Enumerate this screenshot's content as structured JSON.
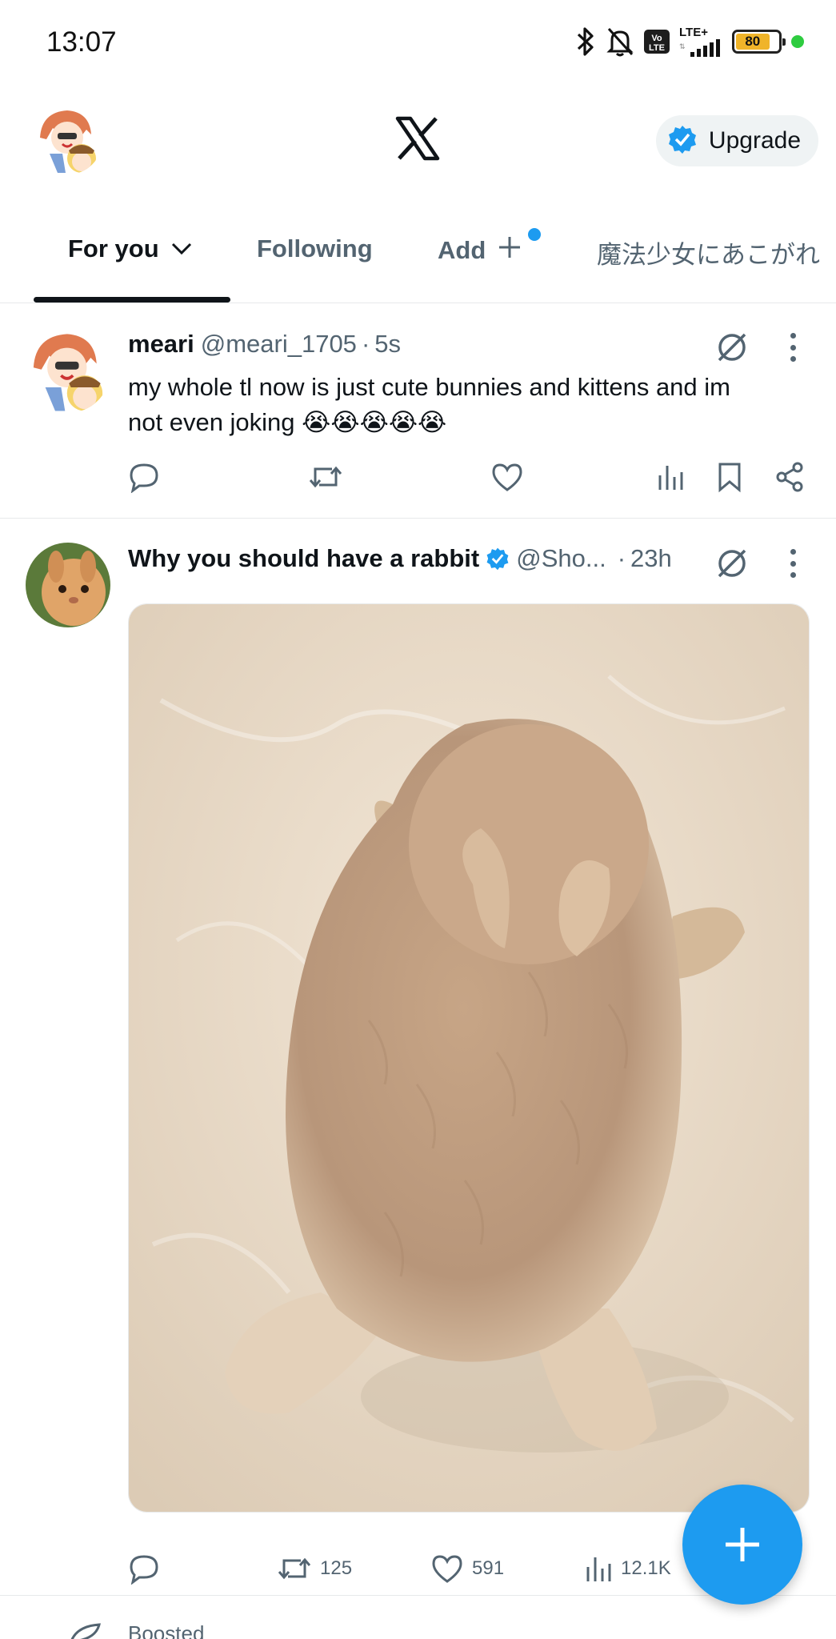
{
  "status_bar": {
    "time": "13:07",
    "network": "LTE+",
    "volte": "Vo LTE",
    "battery_level": "80",
    "battery_fraction": 0.8,
    "icons": [
      "bluetooth-icon",
      "mute-bell-icon",
      "volte-icon",
      "signal-icon",
      "battery-icon"
    ]
  },
  "header": {
    "logo": "x-logo-icon",
    "upgrade_label": "Upgrade"
  },
  "tabs": [
    {
      "label": "For you",
      "active": true
    },
    {
      "label": "Following",
      "active": false
    },
    {
      "label": "Add",
      "active": false
    },
    {
      "label": "魔法少女にあこがれ",
      "active": false
    }
  ],
  "posts": [
    {
      "name": "meari",
      "handle": "@meari_1705",
      "separator": "·",
      "time": "5s",
      "text_line1": "my whole tl now is just cute bunnies and kittens and im",
      "text_line2": "not even joking 😭😭😭😭😭",
      "verified": false,
      "actions": {
        "reply": "",
        "repost": "",
        "like": "",
        "views": ""
      }
    },
    {
      "name": "Why you should have a rabbit",
      "handle": "@Sho...",
      "separator": "·",
      "time": "23h",
      "verified": true,
      "media": "photo of a tan rabbit lying flat on a marble floor",
      "actions": {
        "reply": "",
        "repost": "125",
        "like": "591",
        "views": "12.1K"
      }
    }
  ],
  "next_post": {
    "context": "Boosted"
  },
  "colors": {
    "accent": "#1d9bf0",
    "text": "#0f1419",
    "muted": "#536471",
    "divider": "#e7e9ea"
  }
}
